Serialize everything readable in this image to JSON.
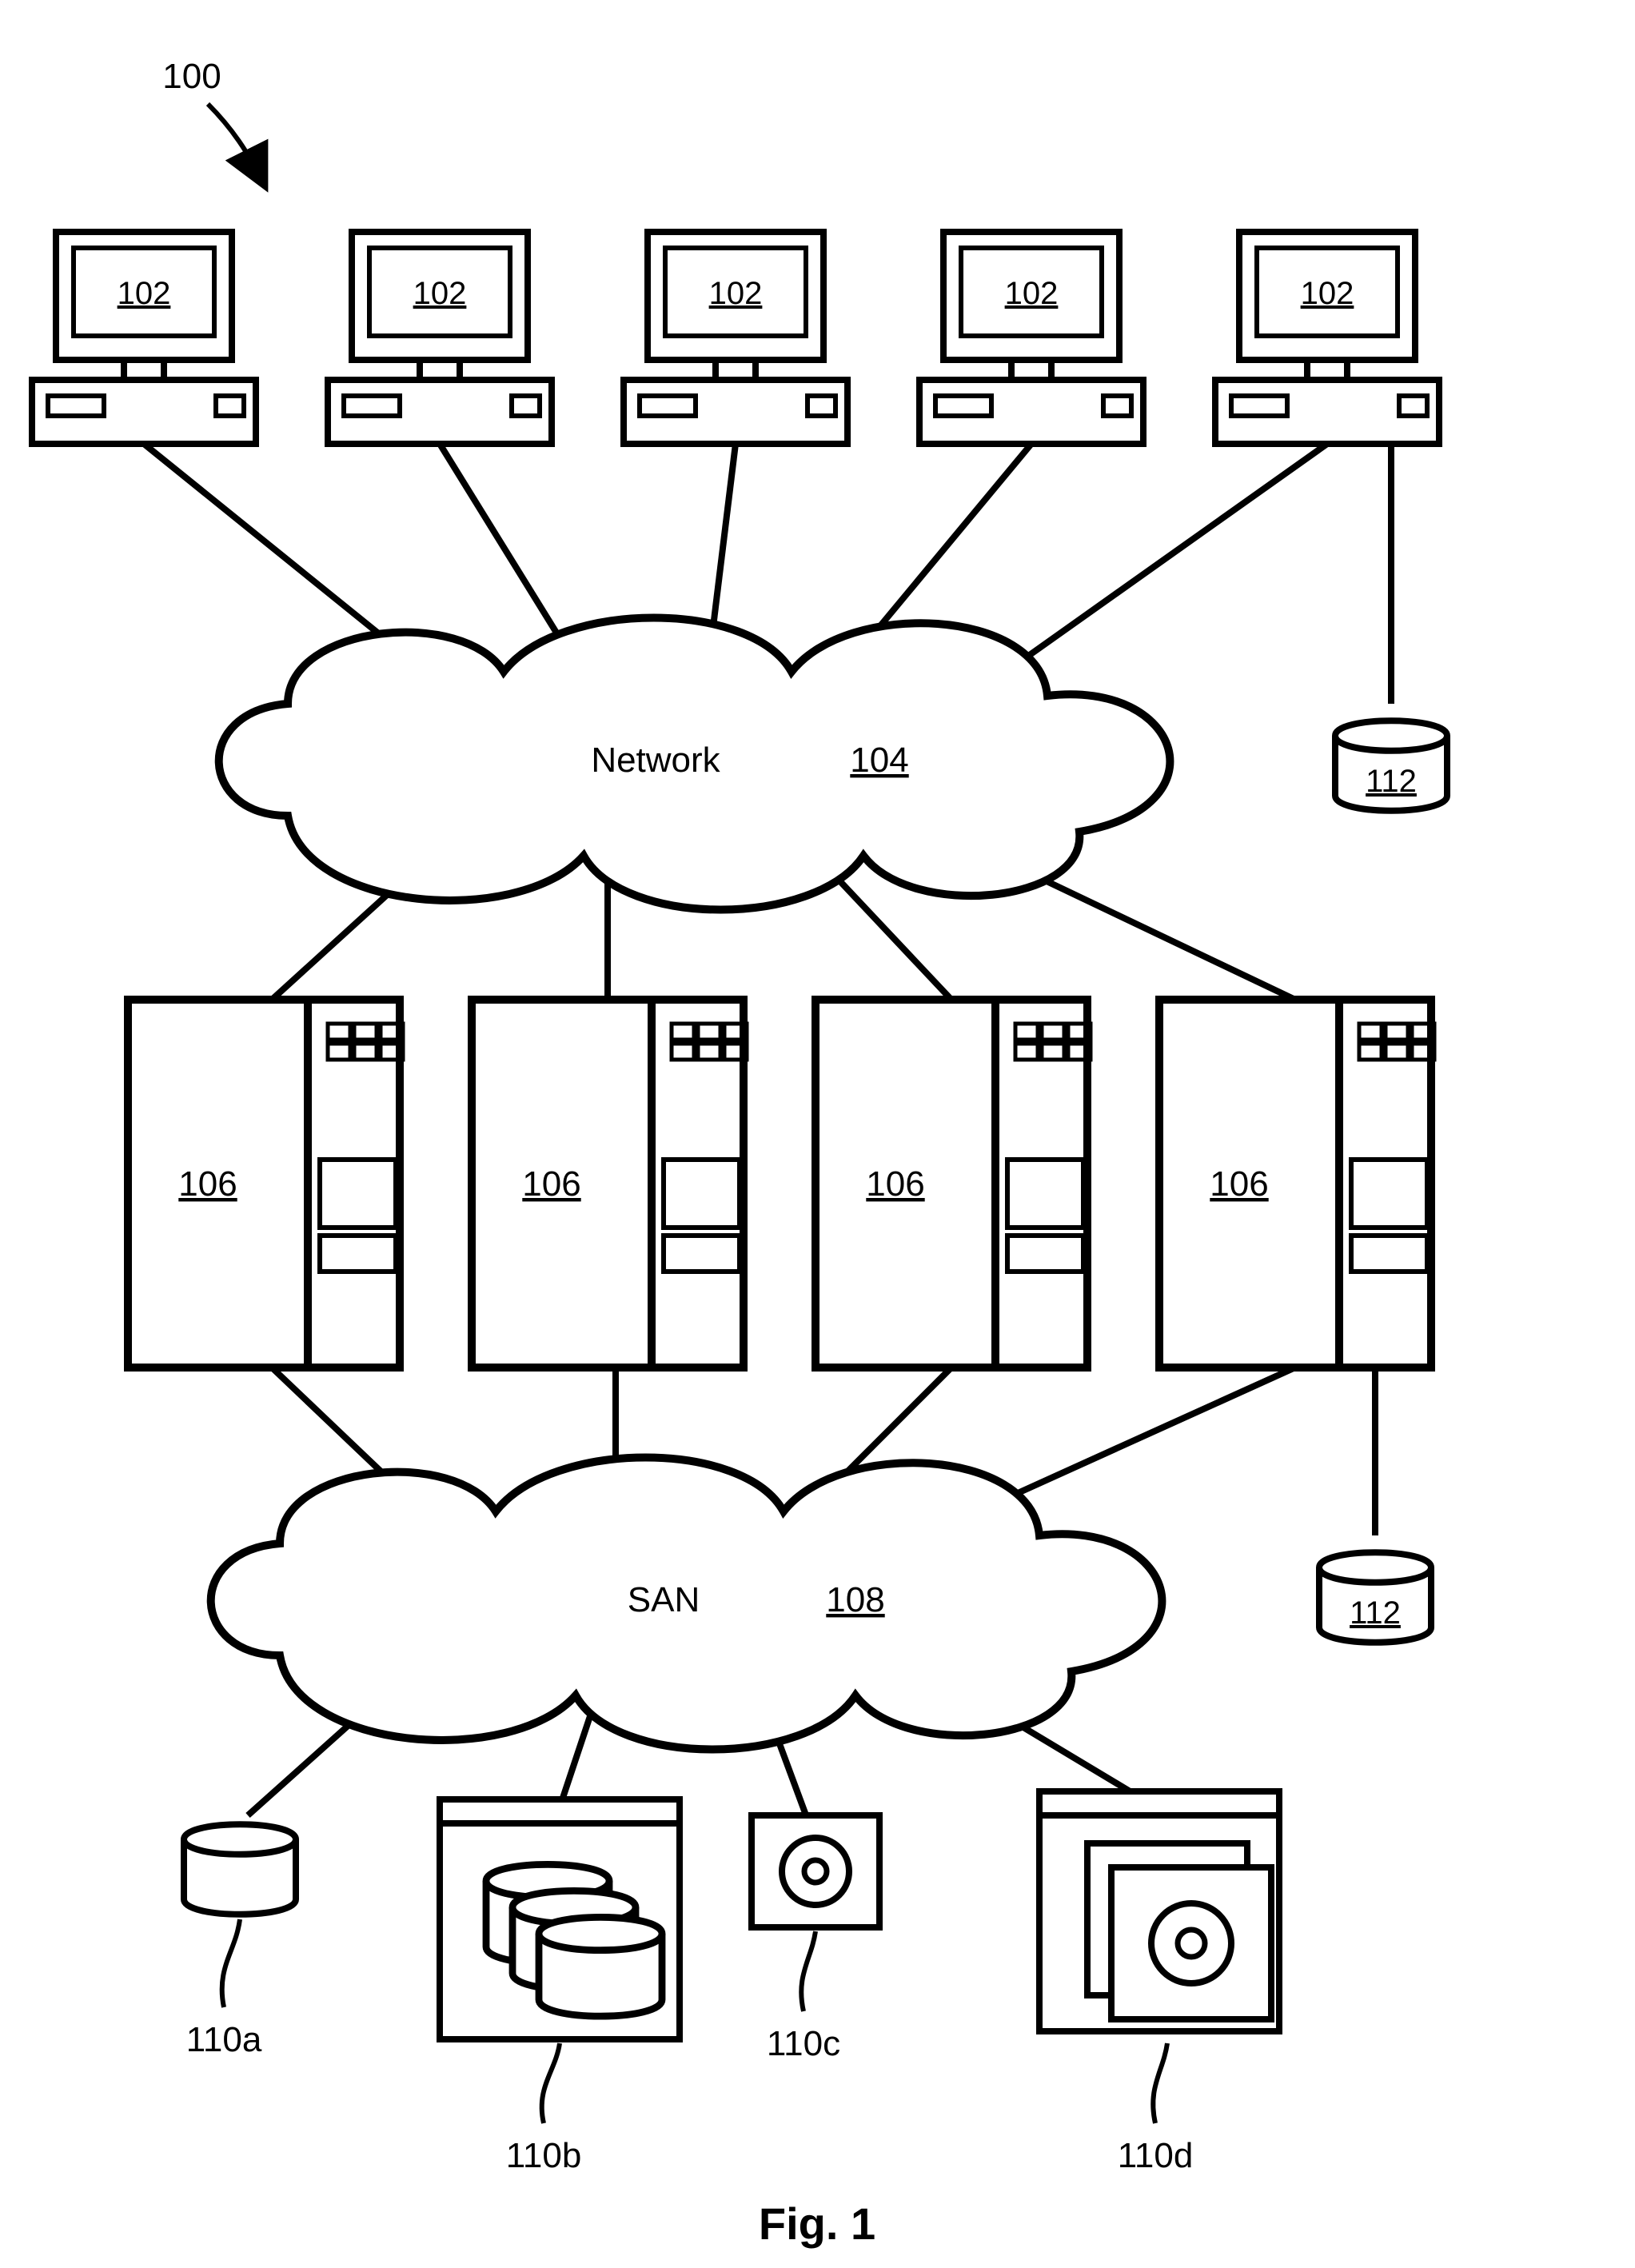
{
  "figure_ref": "100",
  "clients": {
    "labels": [
      "102",
      "102",
      "102",
      "102",
      "102"
    ]
  },
  "network": {
    "label": "Network",
    "ref": "104"
  },
  "servers": {
    "labels": [
      "106",
      "106",
      "106",
      "106"
    ]
  },
  "san": {
    "label": "SAN",
    "ref": "108"
  },
  "das_top": {
    "ref": "112"
  },
  "das_bottom": {
    "ref": "112"
  },
  "storage": {
    "labels": [
      "110a",
      "110b",
      "110c",
      "110d"
    ]
  },
  "caption": "Fig. 1"
}
